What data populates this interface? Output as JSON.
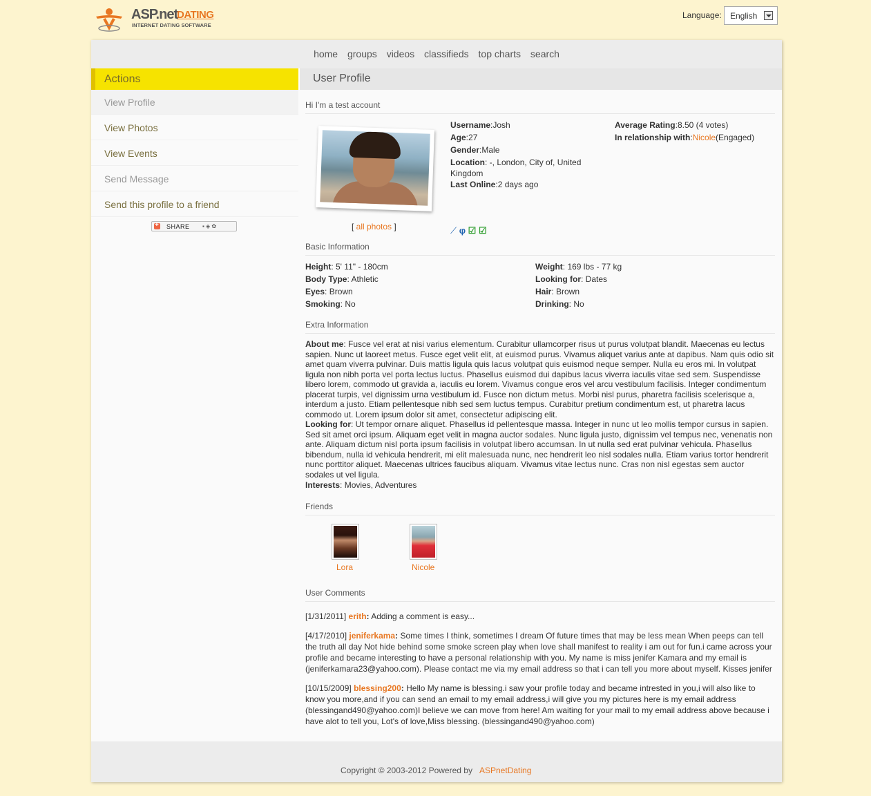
{
  "header": {
    "logo_primary": "ASP.net",
    "logo_secondary": "DATING",
    "logo_tagline": "INTERNET DATING SOFTWARE",
    "language_label": "Language:",
    "language_value": "English"
  },
  "nav": [
    "home",
    "groups",
    "videos",
    "classifieds",
    "top charts",
    "search"
  ],
  "sidebar": {
    "title": "Actions",
    "items": [
      {
        "label": "View Profile",
        "state": "disabled"
      },
      {
        "label": "View Photos",
        "state": "link"
      },
      {
        "label": "View Events",
        "state": "link"
      },
      {
        "label": "Send Message",
        "state": "disabled"
      },
      {
        "label": "Send this profile to a friend",
        "state": "link"
      }
    ],
    "share_label": "SHARE"
  },
  "profile": {
    "title": "User Profile",
    "greeting": "Hi I'm a test account",
    "all_photos": "[ all photos ]",
    "all_photos_open": "[ ",
    "all_photos_link": "all photos",
    "all_photos_close": " ]",
    "username_label": "Username",
    "username": "Josh",
    "age_label": "Age",
    "age": "27",
    "gender_label": "Gender",
    "gender": "Male",
    "location_label": "Location",
    "location_line1": ": -, London, City of, United",
    "location_line2": "Kingdom",
    "last_online_label": "Last Online",
    "last_online": "2 days ago",
    "rating_label": "Average Rating",
    "rating": "8.50 (4 votes)",
    "relationship_label": "In relationship with",
    "relationship_name": "Nicole",
    "relationship_status": "(Engaged)"
  },
  "basic": {
    "title": "Basic Information",
    "left": [
      {
        "label": "Height",
        "value": ": 5' 11\" - 180cm"
      },
      {
        "label": "Body Type",
        "value": ": Athletic"
      },
      {
        "label": "Eyes",
        "value": ": Brown"
      },
      {
        "label": "Smoking",
        "value": ": No"
      }
    ],
    "right": [
      {
        "label": "Weight",
        "value": ": 169 lbs - 77 kg"
      },
      {
        "label": "Looking for",
        "value": ": Dates"
      },
      {
        "label": "Hair",
        "value": ": Brown"
      },
      {
        "label": "Drinking",
        "value": ": No"
      }
    ]
  },
  "extra": {
    "title": "Extra Information",
    "about_label": "About me",
    "about_text": ": Fusce vel erat at nisi varius elementum. Curabitur ullamcorper risus ut purus volutpat blandit. Maecenas eu lectus sapien. Nunc ut laoreet metus. Fusce eget velit elit, at euismod purus. Vivamus aliquet varius ante at dapibus. Nam quis odio sit amet quam viverra pulvinar. Duis mattis ligula quis lacus volutpat quis euismod neque semper. Nulla eu eros mi. In volutpat ligula non nibh porta vel porta lectus luctus. Phasellus euismod dui dapibus lacus viverra iaculis vitae sed sem. Suspendisse libero lorem, commodo ut gravida a, iaculis eu lorem. Vivamus congue eros vel arcu vestibulum facilisis. Integer condimentum placerat turpis, vel dignissim urna vestibulum id. Fusce non dictum metus. Morbi nisl purus, pharetra facilisis scelerisque a, interdum a justo. Etiam pellentesque nibh sed sem luctus tempus. Curabitur pretium condimentum est, ut pharetra lacus commodo ut. Lorem ipsum dolor sit amet, consectetur adipiscing elit.",
    "looking_label": "Looking for",
    "looking_text": ": Ut tempor ornare aliquet. Phasellus id pellentesque massa. Integer in nunc ut leo mollis tempor cursus in sapien. Sed sit amet orci ipsum. Aliquam eget velit in magna auctor sodales. Nunc ligula justo, dignissim vel tempus nec, venenatis non ante. Aliquam dictum nisl porta ipsum facilisis in volutpat libero accumsan. In ut nulla sed erat pulvinar vehicula. Phasellus bibendum, nulla id vehicula hendrerit, mi elit malesuada nunc, nec hendrerit leo nisl sodales nulla. Etiam varius tortor hendrerit nunc porttitor aliquet. Maecenas ultrices faucibus aliquam. Vivamus vitae lectus nunc. Cras non nisl egestas sem auctor sodales ut vel ligula.",
    "interests_label": "Interests",
    "interests_text": ": Movies, Adventures"
  },
  "friends": {
    "title": "Friends",
    "list": [
      "Lora",
      "Nicole"
    ]
  },
  "comments": {
    "title": "User Comments",
    "list": [
      {
        "date": "[1/31/2011]",
        "user": "erith",
        "text": "Adding a comment is easy..."
      },
      {
        "date": "[4/17/2010]",
        "user": "jeniferkama",
        "text": "Some times I think, sometimes I dream Of future times that may be less mean When peeps can tell the truth all day Not hide behind some smoke screen play when love shall manifest to reality i am out for fun.i came across your profile and became interesting to have a personal relationship with you. My name is miss jenifer Kamara and my email is (jeniferkamara23@yahoo.com). Please contact me via my email address so that i can tell you more about myself. Kisses jenifer"
      },
      {
        "date": "[10/15/2009]",
        "user": "blessing200",
        "text": "Hello My name is blessing.i saw your profile today and became intrested in you,i will also like to know you more,and if you can send an email to my email address,i will give you my pictures here is my email address (blessingand490@yahoo.com)I believe we can move from here! Am waiting for your mail to my email address above because i have alot to tell you, Lot's of love,Miss blessing. (blessingand490@yahoo.com)"
      }
    ]
  },
  "footer": {
    "copyright": "Copyright © 2003-2012 Powered by",
    "link": "ASPnetDating"
  },
  "colors": {
    "accent": "#e87722",
    "actions_bg": "#f6e300",
    "page_bg": "#fdf4cf"
  }
}
